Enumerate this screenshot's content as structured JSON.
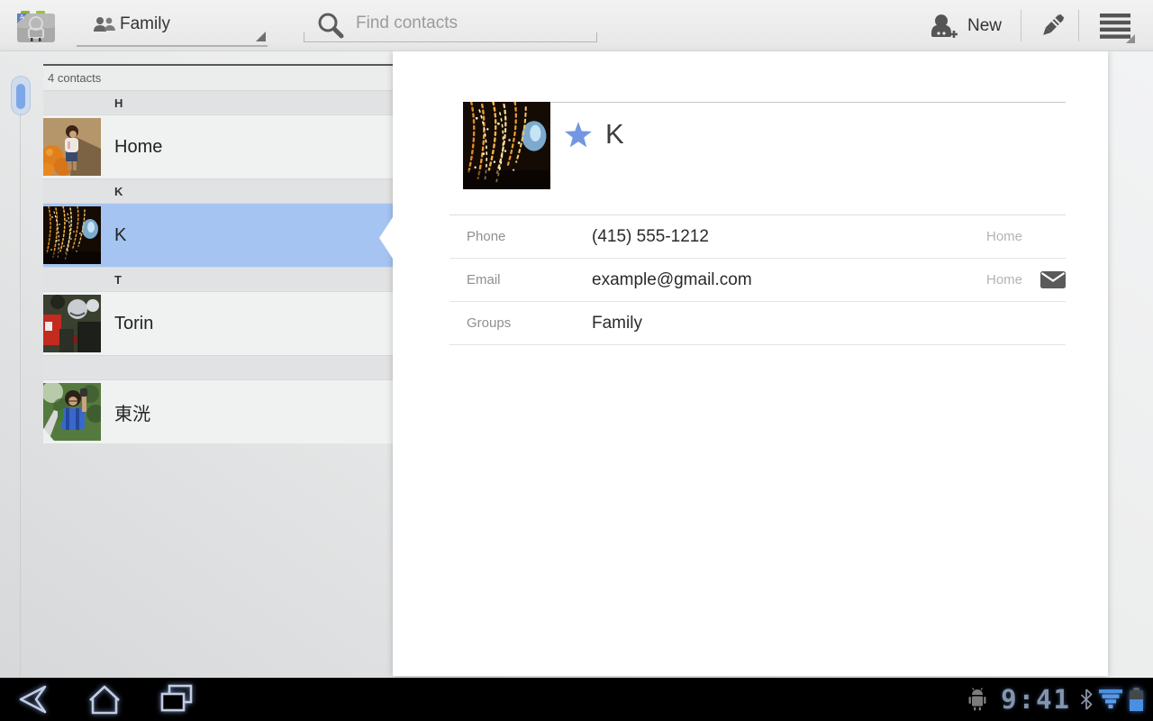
{
  "action_bar": {
    "app_icon": "contacts-app-icon",
    "group_filter": {
      "label": "Family",
      "icon": "group-icon"
    },
    "search": {
      "placeholder": "Find contacts",
      "icon": "search-icon"
    },
    "new_button": {
      "label": "New",
      "icon": "add-contact-icon"
    },
    "edit_icon": "pencil-icon",
    "menu_icon": "menu-icon"
  },
  "contact_list": {
    "count_label": "4 contacts",
    "sections": [
      {
        "letter": "H",
        "contacts": [
          {
            "name": "Home",
            "photo": "girl-pumpkin-patch",
            "selected": false
          }
        ]
      },
      {
        "letter": "K",
        "contacts": [
          {
            "name": "K",
            "photo": "fireworks",
            "selected": true
          }
        ]
      },
      {
        "letter": "T",
        "contacts": [
          {
            "name": "Torin",
            "photo": "football-players",
            "selected": false
          }
        ]
      },
      {
        "letter": "",
        "contacts": [
          {
            "name": "東洸",
            "photo": "boy-life-vest",
            "selected": false
          }
        ]
      }
    ]
  },
  "detail": {
    "name": "K",
    "starred": true,
    "photo": "fireworks",
    "rows": [
      {
        "label": "Phone",
        "value": "(415) 555-1212",
        "type": "Home",
        "action_icon": ""
      },
      {
        "label": "Email",
        "value": "example@gmail.com",
        "type": "Home",
        "action_icon": "email-icon"
      },
      {
        "label": "Groups",
        "value": "Family",
        "type": "",
        "action_icon": ""
      }
    ]
  },
  "system_bar": {
    "clock": "9:41",
    "nav_buttons": [
      "back",
      "home",
      "recents"
    ],
    "status_icons": [
      "usb-debug-icon",
      "bluetooth-icon",
      "signal-icon",
      "battery-icon"
    ]
  },
  "colors": {
    "selection_blue": "#a5c4f1",
    "star_blue": "#7396e2",
    "status_blue": "#4a8fe0",
    "action_bar_bg": "#eeeeee",
    "system_bar_bg": "#000000"
  }
}
